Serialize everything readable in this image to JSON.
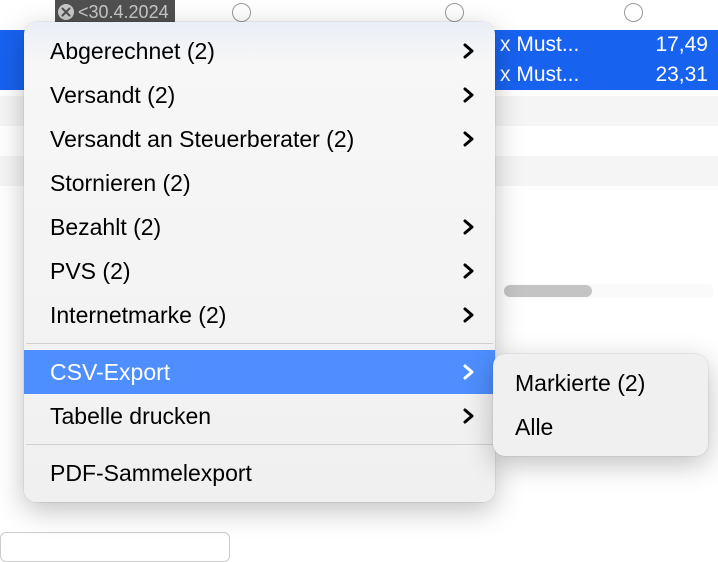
{
  "filter_pill": "<30.4.2024",
  "rows": [
    {
      "name": "x Must...",
      "amount": "17,49"
    },
    {
      "name": "x Must...",
      "amount": "23,31"
    }
  ],
  "menu": {
    "items": [
      {
        "label": "Abgerechnet (2)",
        "submenu": true
      },
      {
        "label": "Versandt (2)",
        "submenu": true
      },
      {
        "label": "Versandt an Steuerberater (2)",
        "submenu": true
      },
      {
        "label": "Stornieren (2)",
        "submenu": false
      },
      {
        "label": "Bezahlt (2)",
        "submenu": true
      },
      {
        "label": "PVS (2)",
        "submenu": true
      },
      {
        "label": "Internetmarke (2)",
        "submenu": true
      }
    ],
    "csv_export": "CSV-Export",
    "tabelle_drucken": "Tabelle drucken",
    "pdf_sammelexport": "PDF-Sammelexport"
  },
  "submenu": {
    "markierte": "Markierte (2)",
    "alle": "Alle"
  }
}
